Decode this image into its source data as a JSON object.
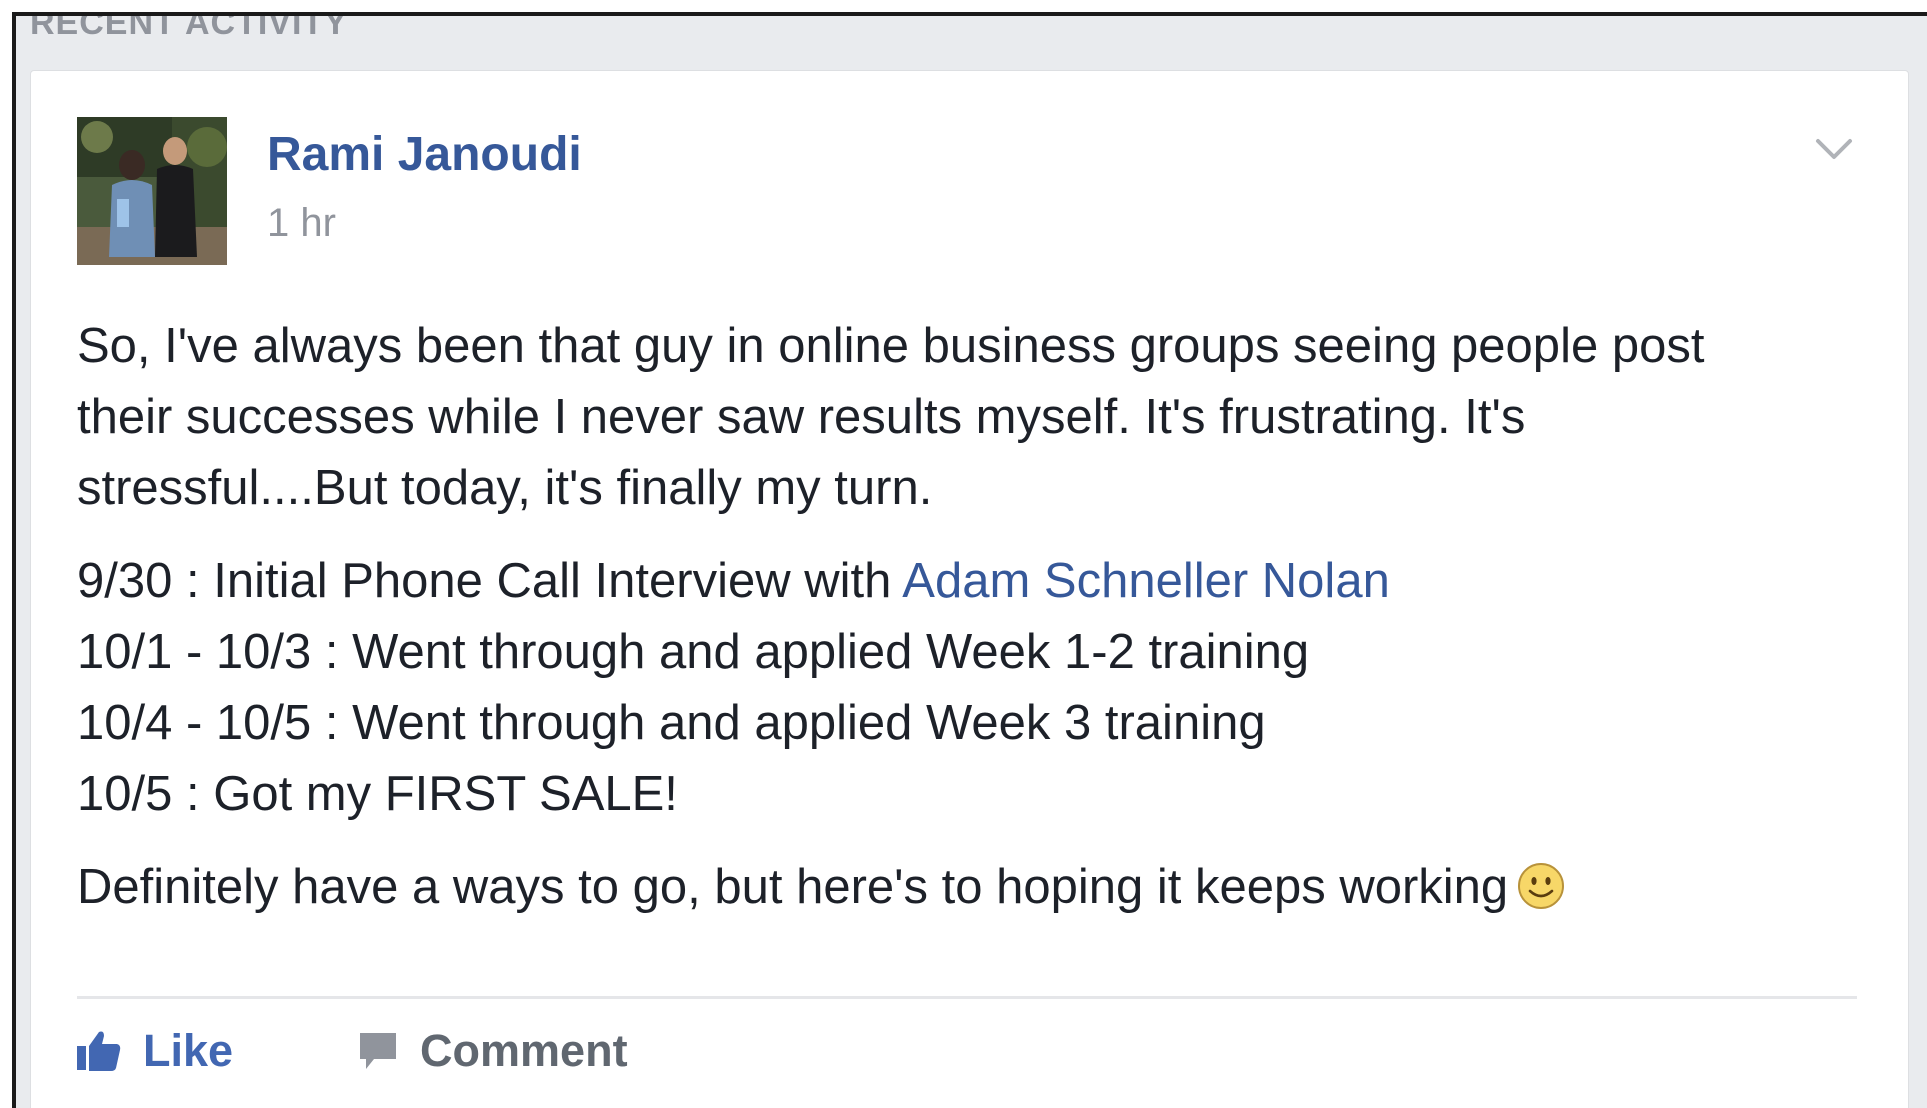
{
  "section": {
    "header": "RECENT ACTIVITY"
  },
  "post": {
    "author": "Rami Janoudi",
    "timestamp": "1 hr",
    "paragraph1": [
      "So, I've always been that guy in online business groups seeing people post",
      "their successes while I never saw results myself. It's frustrating. It's",
      "stressful....But today, it's finally my turn."
    ],
    "timeline": {
      "line1_prefix": "9/30 : Initial Phone Call Interview with ",
      "line1_mention": "Adam Schneller Nolan",
      "line2": "10/1 - 10/3 : Went through and applied Week 1-2 training",
      "line3": "10/4 - 10/5 : Went through and applied Week 3 training",
      "line4": "10/5 : Got my FIRST SALE!"
    },
    "closing": "Definitely have a ways to go, but here's to hoping it keeps working"
  },
  "actions": {
    "like_label": "Like",
    "comment_label": "Comment"
  },
  "icons": {
    "avatar": "profile-photo",
    "options": "chevron-down-icon",
    "emoji": "smiley-icon",
    "like": "thumbs-up-icon",
    "comment": "speech-bubble-icon"
  },
  "colors": {
    "link": "#365899",
    "like_blue": "#4267b2",
    "text": "#1d2129",
    "secondary": "#90949c",
    "page_bg": "#e9ebee"
  }
}
